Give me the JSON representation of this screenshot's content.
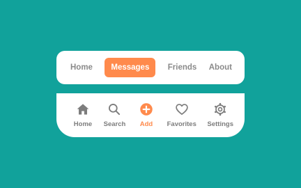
{
  "colors": {
    "background": "#11a29b",
    "card": "#ffffff",
    "accent": "#ff8a4c",
    "inactive": "#8a8a8a"
  },
  "top_nav": {
    "items": [
      {
        "label": "Home",
        "active": false
      },
      {
        "label": "Messages",
        "active": true
      },
      {
        "label": "Friends",
        "active": false
      },
      {
        "label": "About",
        "active": false
      }
    ]
  },
  "bottom_nav": {
    "items": [
      {
        "label": "Home",
        "icon": "home-icon",
        "active": false
      },
      {
        "label": "Search",
        "icon": "search-icon",
        "active": false
      },
      {
        "label": "Add",
        "icon": "add-icon",
        "active": true
      },
      {
        "label": "Favorites",
        "icon": "heart-icon",
        "active": false
      },
      {
        "label": "Settings",
        "icon": "gear-icon",
        "active": false
      }
    ]
  }
}
